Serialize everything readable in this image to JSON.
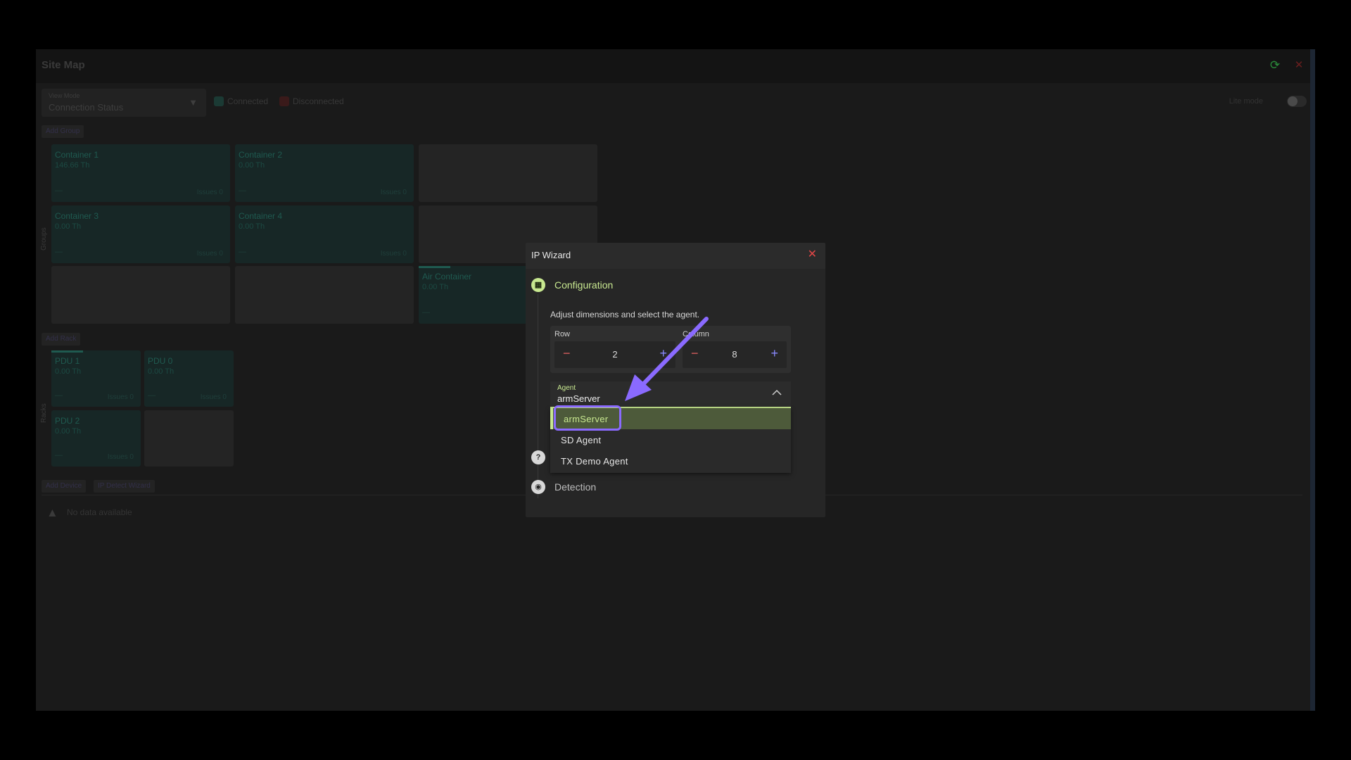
{
  "app": {
    "title": "Site Map",
    "view_mode": {
      "label": "View Mode",
      "value": "Connection Status"
    },
    "legend": [
      {
        "label": "Connected",
        "color": "#1b3a34"
      },
      {
        "label": "Disconnected",
        "color": "#3a1a1a"
      }
    ],
    "lite_mode_label": "Lite mode",
    "add_group_label": "Add Group",
    "groups_side_label": "Groups",
    "groups": [
      {
        "name": "Container 1",
        "value": "146.66 Th",
        "dash": "—",
        "issues": "Issues 0"
      },
      {
        "name": "Container 2",
        "value": "0.00 Th",
        "dash": "—",
        "issues": "Issues 0"
      },
      {
        "name": "Container 3",
        "value": "0.00 Th",
        "dash": "—",
        "issues": "Issues 0"
      },
      {
        "name": "Container 4",
        "value": "0.00 Th",
        "dash": "—",
        "issues": "Issues 0"
      },
      {
        "name": "Air Container",
        "value": "0.00 Th",
        "dash": "—"
      }
    ],
    "add_rack_label": "Add Rack",
    "racks_side_label": "Racks",
    "racks": [
      {
        "name": "PDU 1",
        "value": "0.00 Th",
        "dash": "—",
        "issues": "Issues 0"
      },
      {
        "name": "PDU 0",
        "value": "0.00 Th",
        "dash": "—",
        "issues": "Issues 0"
      },
      {
        "name": "PDU 2",
        "value": "0.00 Th",
        "dash": "—",
        "issues": "Issues 0"
      }
    ],
    "add_device_label": "Add Device",
    "ip_wizard_button_label": "IP Detect Wizard",
    "no_data_text": "No data available"
  },
  "dialog": {
    "title": "IP Wizard",
    "close_glyph": "✕",
    "steps": {
      "config": {
        "label": "Configuration",
        "description": "Adjust dimensions and select the agent."
      },
      "detection": {
        "label": "Detection"
      }
    },
    "row": {
      "label": "Row",
      "value": "2"
    },
    "column": {
      "label": "Column",
      "value": "8"
    },
    "agent": {
      "label": "Agent",
      "value": "armServer",
      "options": [
        "armServer",
        "SD Agent",
        "TX Demo Agent"
      ]
    }
  },
  "colors": {
    "accent": "#c8e890",
    "annotation": "#8a6aff",
    "danger": "#e04646"
  }
}
